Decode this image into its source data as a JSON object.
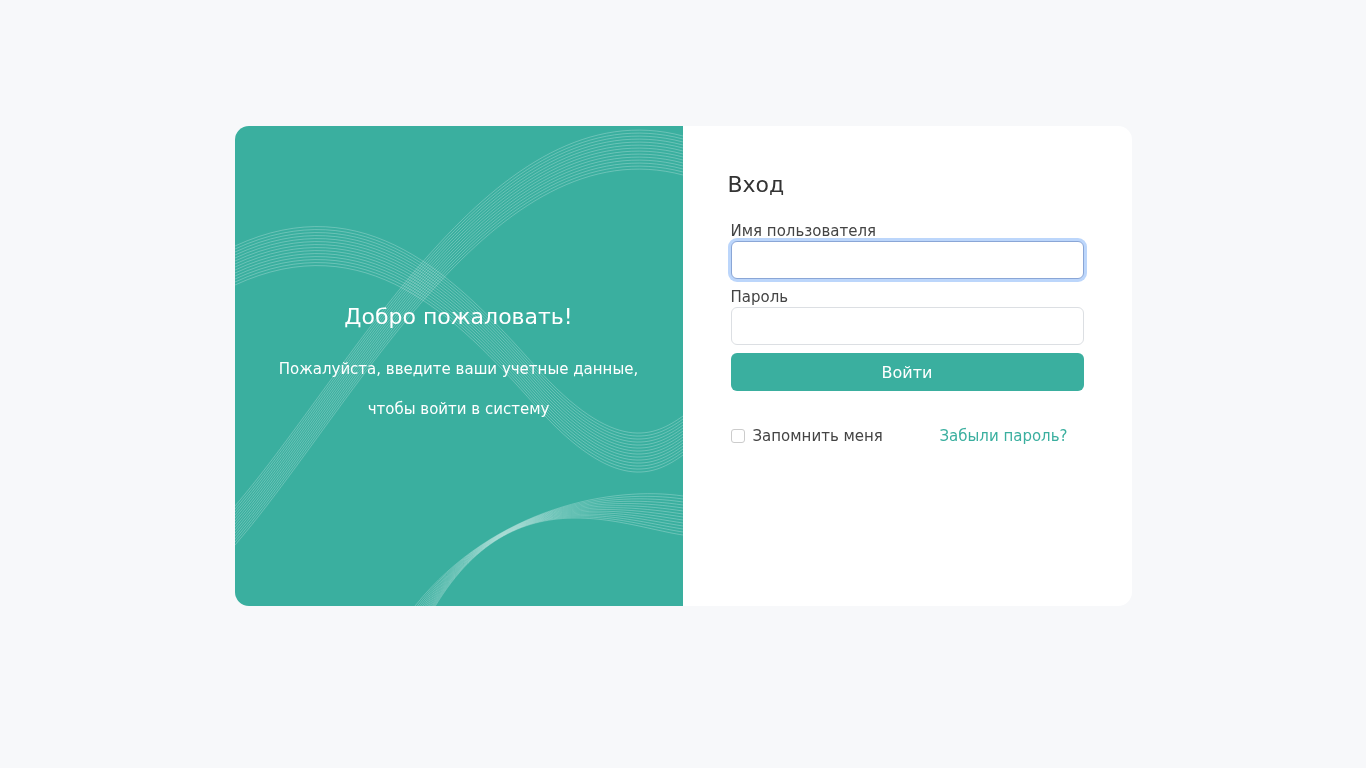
{
  "welcome": {
    "title": "Добро пожаловать!",
    "lines": [
      "Пожалуйста, введите ваши учетные данные,",
      "чтобы войти в систему"
    ]
  },
  "form": {
    "title": "Вход",
    "fields": [
      {
        "label": "Имя пользователя",
        "focused": true
      },
      {
        "label": "Пароль",
        "focused": false
      }
    ],
    "submit": "Войти",
    "remember": {
      "label": "Запомнить меня",
      "checked": false
    },
    "forgot": "Забыли пароль?"
  }
}
